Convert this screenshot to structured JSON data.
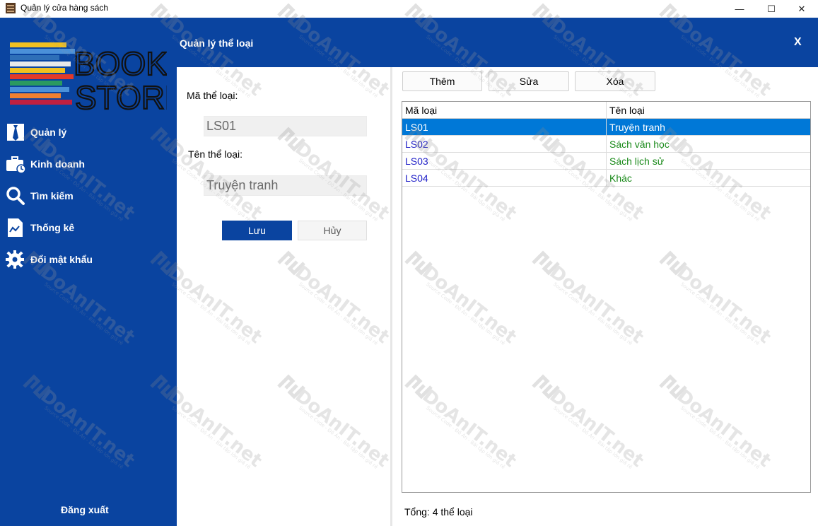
{
  "window": {
    "title": "Quản lý cửa hàng sách",
    "minimize": "—",
    "maximize": "☐",
    "close": "✕"
  },
  "sidebar": {
    "logo_line1": "BOOK",
    "logo_line2": "STORE",
    "items": [
      {
        "label": "Quản lý",
        "icon": "tie-icon"
      },
      {
        "label": "Kinh doanh",
        "icon": "briefcase-icon"
      },
      {
        "label": "Tìm kiếm",
        "icon": "search-icon"
      },
      {
        "label": "Thống kê",
        "icon": "report-icon"
      },
      {
        "label": "Đổi mật khẩu",
        "icon": "gear-icon"
      }
    ],
    "logout": "Đăng xuất"
  },
  "header": {
    "title": "Quản lý thể loại",
    "close": "X"
  },
  "form": {
    "code_label": "Mã thể loại:",
    "code_value": "LS01",
    "name_label": "Tên thể loại:",
    "name_value": "Truyện tranh",
    "save": "Lưu",
    "cancel": "Hủy"
  },
  "toolbar": {
    "add": "Thêm",
    "edit": "Sửa",
    "delete": "Xóa"
  },
  "table": {
    "columns": [
      "Mã loại",
      "Tên loại"
    ],
    "rows": [
      {
        "code": "LS01",
        "name": "Truyện tranh"
      },
      {
        "code": "LS02",
        "name": "Sách văn học"
      },
      {
        "code": "LS03",
        "name": "Sách lịch sử"
      },
      {
        "code": "LS04",
        "name": "Khác"
      }
    ],
    "selected_row": 0
  },
  "footer": {
    "total": "Tổng: 4 thể loại"
  },
  "watermark": {
    "text": "DoAnIT.net",
    "sub": "Source Code - Đồ Án - Bài tập lớn giá rẻ"
  },
  "colors": {
    "brand": "#0a44a0",
    "selection": "#0078d7",
    "code_text": "#2020c8",
    "name_text": "#1a8a1a"
  }
}
